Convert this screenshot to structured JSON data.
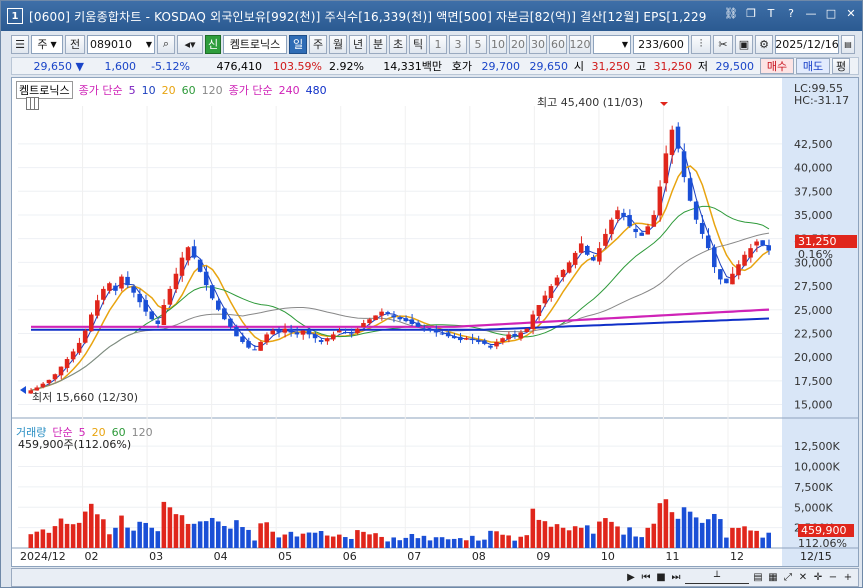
{
  "window": {
    "number": "1",
    "title": "[0600] 키움종합차트 - KOSDAQ 외국인보유[992(천)] 주식수[16,339(천)] 액면[500] 자본금[82(억)] 결산[12월] EPS[1,229"
  },
  "toolbar": {
    "period_type": "주",
    "prev_label": "전",
    "code": "089010",
    "badge_new": "신",
    "company": "켐트로닉스",
    "periods": [
      "일",
      "주",
      "월",
      "년",
      "분",
      "초",
      "틱"
    ],
    "active_period": "일",
    "intervals": [
      "1",
      "3",
      "5",
      "10",
      "20",
      "30",
      "60",
      "120"
    ],
    "count": "233/600",
    "date": "2025/12/16"
  },
  "quote": {
    "price": "29,650",
    "direction": "▼",
    "change": "1,600",
    "change_pct": "-5.12%",
    "volume": "476,410",
    "vol_ratio": "103.59%",
    "turnover": "2.92%",
    "amount": "14,331백만",
    "hoga_label": "호가",
    "ask": "29,700",
    "bid": "29,650",
    "open_label": "시",
    "open": "31,250",
    "high_label": "고",
    "high": "31,250",
    "low_label": "저",
    "low": "29,500",
    "buy": "매수",
    "sell": "매도",
    "even": "평"
  },
  "price_legend": {
    "name": "켐트로닉스",
    "ma_label": "종가 단순",
    "ma": [
      "5",
      "10",
      "20",
      "60",
      "120"
    ],
    "ma2_label": "종가 단순",
    "ma2": [
      "240",
      "480"
    ]
  },
  "annotations": {
    "high": "최고 45,400 (11/03)",
    "low": "최저 15,660 (12/30)",
    "lc": "LC:99.55",
    "hc": "HC:-31.17",
    "last_price": "31,250",
    "last_pct": "0.16%",
    "last_volume": "459,900",
    "last_vol_pct": "112.06%"
  },
  "volume_legend": {
    "name": "거래량",
    "ma_label": "단순",
    "ma": [
      "5",
      "20",
      "60",
      "120"
    ],
    "current": "459,900주(112.06%)"
  },
  "price_axis": [
    "42,500",
    "40,000",
    "37,500",
    "35,000",
    "32,500",
    "30,000",
    "27,500",
    "25,000",
    "22,500",
    "20,000",
    "17,500",
    "15,000"
  ],
  "volume_axis": [
    "12,500K",
    "10,000K",
    "7,500K",
    "5,000K",
    "2,500K"
  ],
  "time_axis": [
    "2024/12",
    "02",
    "03",
    "04",
    "05",
    "06",
    "07",
    "08",
    "09",
    "10",
    "11",
    "12",
    "12/15"
  ],
  "colors": {
    "up": "#e0261c",
    "down": "#1a4fd6",
    "ma5": "#7a1fbf",
    "ma10": "#1b3fbf",
    "ma20": "#e8a410",
    "ma60": "#2e9a3a",
    "ma120": "#888888",
    "ma240": "#cf23b7",
    "ma480": "#1030c8"
  },
  "chart_data": {
    "type": "candlestick",
    "title": "",
    "price_ylim": [
      14000,
      46500
    ],
    "volume_ylim": [
      0,
      13500000
    ],
    "x_start": "2024/12",
    "x_end": "2025/12/16",
    "close_series": [
      16500,
      16800,
      17200,
      17600,
      18200,
      19000,
      19800,
      20600,
      21500,
      22800,
      24500,
      26000,
      27200,
      27800,
      27000,
      28500,
      27600,
      26800,
      25800,
      24800,
      24000,
      23500,
      25500,
      27200,
      28800,
      30500,
      31600,
      30500,
      29000,
      27600,
      26200,
      25000,
      24000,
      23200,
      22200,
      21600,
      21000,
      20800,
      21600,
      22400,
      22800,
      22600,
      23000,
      22600,
      22400,
      22800,
      22400,
      22000,
      21600,
      22000,
      22400,
      22800,
      22600,
      22400,
      23000,
      23600,
      24000,
      24400,
      24800,
      24600,
      24200,
      24000,
      23800,
      23500,
      23200,
      23000,
      22800,
      22600,
      22400,
      22200,
      22000,
      21800,
      22000,
      21800,
      21600,
      21400,
      21000,
      21600,
      22000,
      22400,
      22200,
      22600,
      23000,
      24500,
      25500,
      26500,
      27500,
      28400,
      29200,
      30000,
      31000,
      32000,
      30800,
      30200,
      31500,
      33000,
      34500,
      35500,
      34800,
      33800,
      33200,
      32800,
      33800,
      35000,
      38000,
      41500,
      44000,
      42000,
      39000,
      36500,
      34500,
      33000,
      31500,
      29500,
      28200,
      27800,
      28800,
      29800,
      30800,
      31500,
      32200,
      31800,
      31250
    ],
    "ma5": [],
    "ma10": [],
    "ma20": [],
    "ma60": [],
    "ma120": [],
    "ma240": [],
    "ma480": []
  }
}
